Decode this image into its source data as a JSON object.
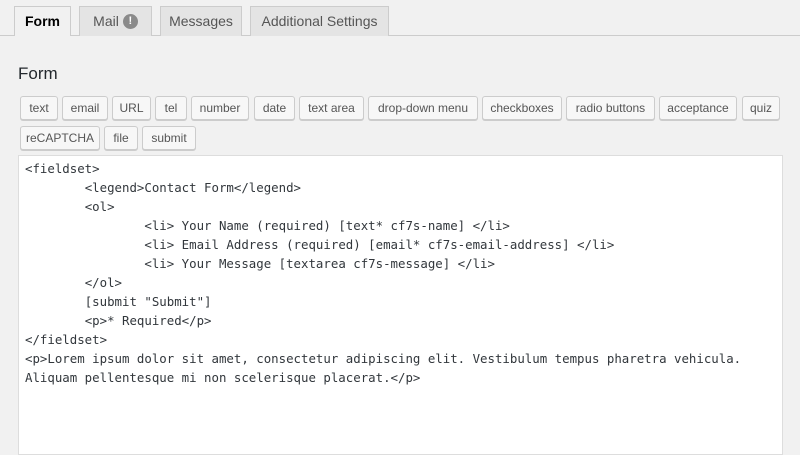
{
  "tabs": [
    {
      "label": "Form",
      "active": true
    },
    {
      "label": "Mail",
      "badge": "!"
    },
    {
      "label": "Messages"
    },
    {
      "label": "Additional Settings"
    }
  ],
  "panel": {
    "title": "Form"
  },
  "tag_buttons": [
    "text",
    "email",
    "URL",
    "tel",
    "number",
    "date",
    "text area",
    "drop-down menu",
    "checkboxes",
    "radio buttons",
    "acceptance",
    "quiz",
    "reCAPTCHA",
    "file",
    "submit"
  ],
  "editor": {
    "content": "<fieldset>\n\t<legend>Contact Form</legend>\n\t<ol>\n\t\t<li> Your Name (required) [text* cf7s-name] </li>\n\t\t<li> Email Address (required) [email* cf7s-email-address] </li>\n\t\t<li> Your Message [textarea cf7s-message] </li>\n\t</ol>\n\t[submit \"Submit\"]\n\t<p>* Required</p>\n</fieldset>\n<p>Lorem ipsum dolor sit amet, consectetur adipiscing elit. Vestibulum tempus pharetra vehicula.\nAliquam pellentesque mi non scelerisque placerat.</p>"
  },
  "colors": {
    "background": "#f1f1f1",
    "tab_inactive": "#e4e4e4",
    "border": "#cccccc",
    "badge": "#8a8a8a"
  }
}
